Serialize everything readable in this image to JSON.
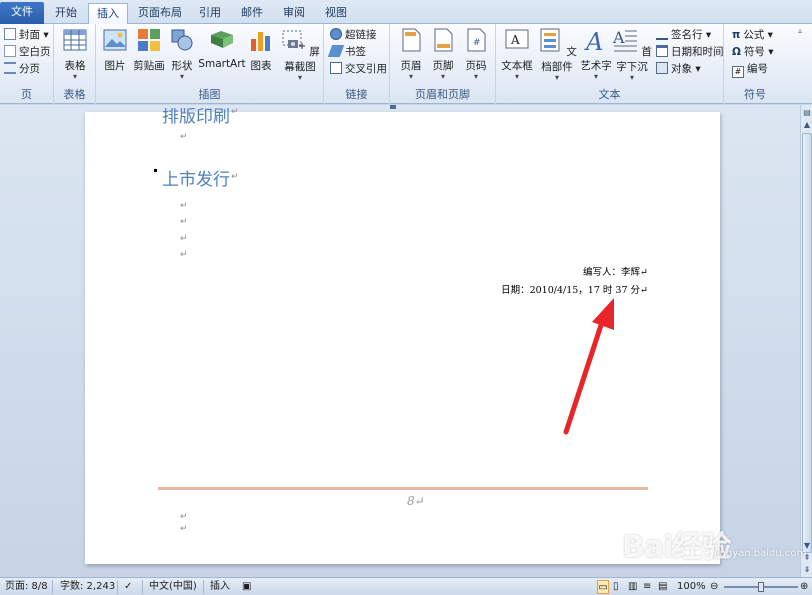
{
  "tabs": [
    {
      "label": "文件"
    },
    {
      "label": "开始"
    },
    {
      "label": "插入"
    },
    {
      "label": "页面布局"
    },
    {
      "label": "引用"
    },
    {
      "label": "邮件"
    },
    {
      "label": "审阅"
    },
    {
      "label": "视图"
    }
  ],
  "ribbon": {
    "pages": {
      "label": "页",
      "cover": "封面",
      "blank": "空白页",
      "break": "分页"
    },
    "tables": {
      "label": "表格",
      "table": "表格"
    },
    "illustrations": {
      "label": "插图",
      "picture": "图片",
      "clipart": "剪贴画",
      "shapes": "形状",
      "smartart": "SmartArt",
      "chart": "图表",
      "screenshot": "屏幕截图"
    },
    "links": {
      "label": "链接",
      "hyperlink": "超链接",
      "bookmark": "书签",
      "crossref": "交叉引用"
    },
    "headerfooter": {
      "label": "页眉和页脚",
      "header": "页眉",
      "footer": "页脚",
      "pagenum": "页码"
    },
    "text": {
      "label": "文本",
      "textbox": "文本框",
      "quickparts": "文档部件",
      "wordart": "艺术字",
      "dropcap": "首字下沉",
      "signature": "签名行",
      "datetime": "日期和时间",
      "object": "对象"
    },
    "symbols": {
      "label": "符号",
      "equation": "公式",
      "symbol": "符号",
      "number": "编号"
    }
  },
  "document": {
    "heading_top_partial": "排版印刷",
    "heading_main": "上市发行",
    "para_mark": "↵",
    "author_line": "编写人：李辉↵",
    "date_line": "日期：2010/4/15，17 时 37 分↵",
    "page_number": "8↵"
  },
  "status": {
    "page": "页面: 8/8",
    "words": "字数: 2,243",
    "language": "中文(中国)",
    "mode": "插入",
    "zoom": "100%"
  },
  "watermark": {
    "text": "Bai经验",
    "sub": "jingyan.baidu.com"
  },
  "colors": {
    "heading": "#4f81bd",
    "annotation_arrow": "#e8262a",
    "footer_rule": "#e8b8a0"
  }
}
